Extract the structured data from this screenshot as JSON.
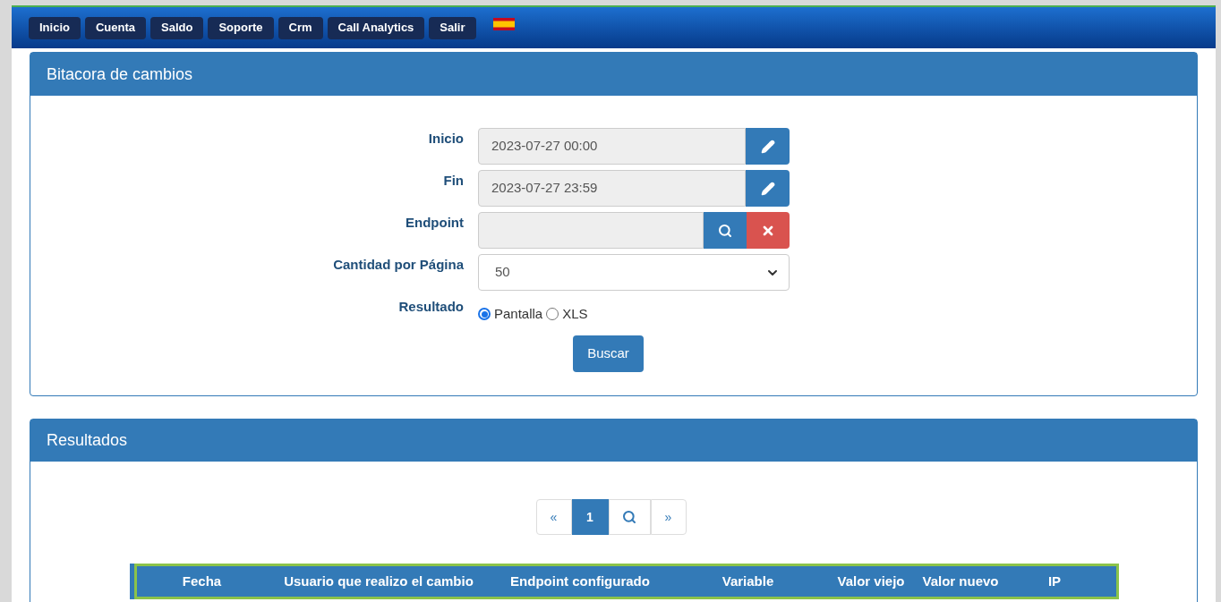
{
  "nav": {
    "items": [
      {
        "label": "Inicio"
      },
      {
        "label": "Cuenta"
      },
      {
        "label": "Saldo"
      },
      {
        "label": "Soporte"
      },
      {
        "label": "Crm"
      },
      {
        "label": "Call Analytics"
      },
      {
        "label": "Salir"
      }
    ]
  },
  "filter_panel": {
    "title": "Bitacora de cambios",
    "fields": [
      {
        "kind": "date",
        "label": "Inicio",
        "value": "2023-07-27 00:00"
      },
      {
        "kind": "date",
        "label": "Fin",
        "value": "2023-07-27 23:59"
      },
      {
        "kind": "lookup",
        "label": "Endpoint"
      },
      {
        "kind": "select",
        "label": "Cantidad por Página",
        "value": "50"
      },
      {
        "kind": "radio",
        "label": "Resultado",
        "options": [
          {
            "label": "Pantalla",
            "selected": true
          },
          {
            "label": "XLS",
            "selected": false
          }
        ]
      }
    ],
    "search_button": "Buscar"
  },
  "results_panel": {
    "title": "Resultados",
    "pagination": {
      "prev": "«",
      "pages": [
        {
          "label": "1",
          "selected": true
        }
      ],
      "next": "»"
    },
    "table": {
      "columns": [
        "Fecha",
        "Usuario que realizo el cambio",
        "Endpoint configurado",
        "Variable",
        "Valor viejo",
        "Valor nuevo",
        "IP"
      ]
    }
  }
}
